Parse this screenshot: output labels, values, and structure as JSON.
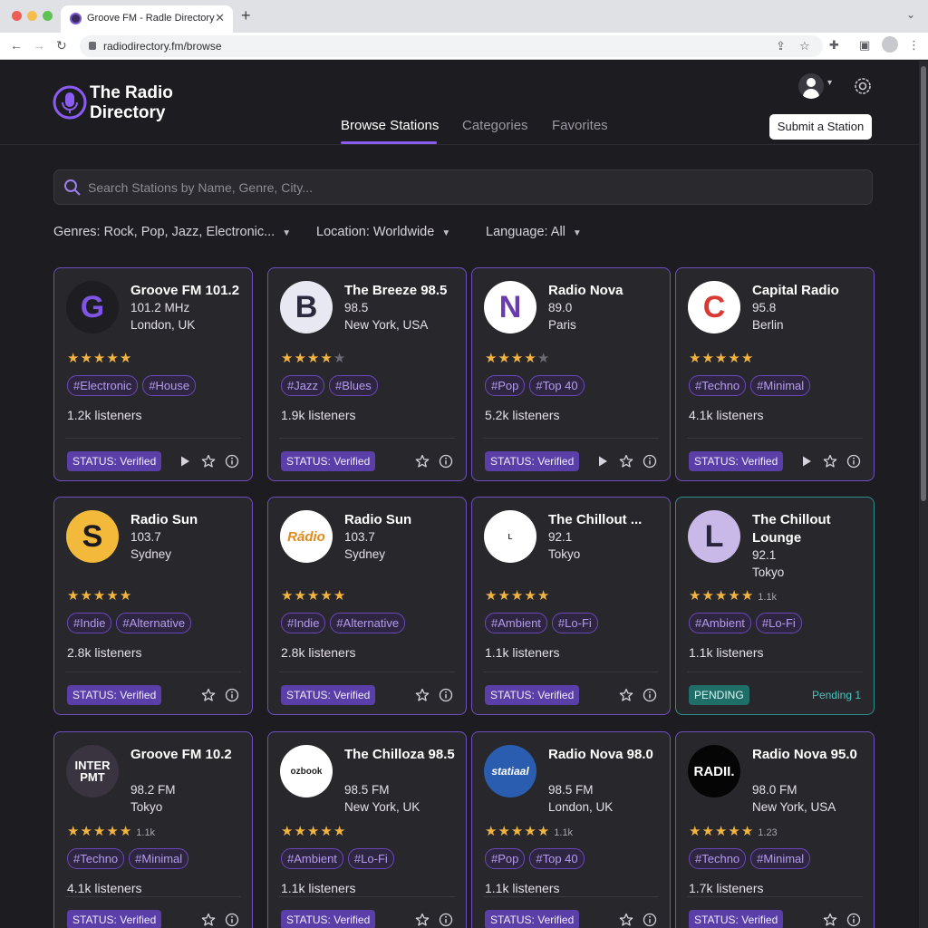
{
  "browser": {
    "tab_title": "Groove FM - Radle Directory",
    "url": "radiodirectory.fm/browse"
  },
  "app": {
    "brand": "The Radio Directory",
    "nav_tabs": [
      "Browse Stations",
      "Categories",
      "Favorites"
    ],
    "active_tab": "Browse Stations",
    "submit_label": "Submit a Station",
    "search_placeholder": "Search Stations by Name, Genre, City...",
    "filters": [
      {
        "label": "Genres:",
        "value": "Rock, Pop, Jazz, Electronic..."
      },
      {
        "label": "Location:",
        "value": "Worldwide"
      },
      {
        "label": "Language:",
        "value": "All"
      }
    ],
    "accent_color": "#8a5cf0",
    "pending_color": "#49c4bd"
  },
  "stations": [
    {
      "name": "Groove FM 101.2",
      "freq": "101.2 MHz",
      "city": "London, UK",
      "logo_text": "G",
      "logo_style": "g",
      "rating": 5,
      "stars_label": "",
      "tags": [
        "#Electronic",
        "#House"
      ],
      "listeners": "1.2k listeners",
      "status": "STATUS: Verified",
      "pending_note": "",
      "play": true
    },
    {
      "name": "The Breeze 98.5",
      "freq": "98.5",
      "city": "New York, USA",
      "logo_text": "B",
      "logo_style": "b",
      "rating": 4.5,
      "stars_label": "",
      "tags": [
        "#Jazz",
        "#Blues"
      ],
      "listeners": "1.9k listeners",
      "status": "STATUS: Verified",
      "pending_note": "",
      "play": false
    },
    {
      "name": "Radio Nova",
      "freq": "89.0",
      "city": "Paris",
      "logo_text": "N",
      "logo_style": "n",
      "rating": 4,
      "stars_label": "",
      "tags": [
        "#Pop",
        "#Top 40"
      ],
      "listeners": "5.2k listeners",
      "status": "STATUS: Verified",
      "pending_note": "",
      "play": true
    },
    {
      "name": "Capital Radio",
      "freq": "95.8",
      "city": "Berlin",
      "logo_text": "C",
      "logo_style": "c",
      "rating": 5,
      "stars_label": "",
      "tags": [
        "#Techno",
        "#Minimal"
      ],
      "listeners": "4.1k listeners",
      "status": "STATUS: Verified",
      "pending_note": "",
      "play": true
    },
    {
      "name": "Radio Sun",
      "freq": "103.7",
      "city": "Sydney",
      "logo_text": "S",
      "logo_style": "s",
      "rating": 5,
      "stars_label": "",
      "tags": [
        "#Indie",
        "#Alternative"
      ],
      "listeners": "2.8k listeners",
      "status": "STATUS: Verified",
      "pending_note": "",
      "play": false
    },
    {
      "name": "Radio Sun",
      "freq": "103.7",
      "city": "Sydney",
      "logo_text": "Rádio",
      "logo_style": "radio",
      "rating": 5,
      "stars_label": "",
      "tags": [
        "#Indie",
        "#Alternative"
      ],
      "listeners": "2.8k listeners",
      "status": "STATUS: Verified",
      "pending_note": "",
      "play": false
    },
    {
      "name": "The Chillout ...",
      "freq": "92.1",
      "city": "Tokyo",
      "logo_text": "L",
      "logo_style": "chill",
      "rating": 5,
      "stars_label": "",
      "tags": [
        "#Ambient",
        "#Lo-Fi"
      ],
      "listeners": "1.1k listeners",
      "status": "STATUS: Verified",
      "pending_note": "",
      "play": false
    },
    {
      "name": "The Chillout Lounge",
      "freq": "92.1",
      "city": "Tokyo",
      "logo_text": "L",
      "logo_style": "l",
      "rating": 5,
      "stars_label": "1.1k",
      "tags": [
        "#Ambient",
        "#Lo-Fi"
      ],
      "listeners": "1.1k listeners",
      "status": "PENDING",
      "pending_note": "Pending 1",
      "play": false
    },
    {
      "name": "Groove FM 10.2",
      "freq": "98.2 FM",
      "city": "Tokyo",
      "logo_text": "INTER PMT",
      "logo_style": "inter",
      "rating": 5,
      "stars_label": "1.1k",
      "tags": [
        "#Techno",
        "#Minimal"
      ],
      "listeners": "4.1k listeners",
      "status": "STATUS: Verified",
      "pending_note": "",
      "play": false
    },
    {
      "name": "The Chilloza 98.5",
      "freq": "98.5 FM",
      "city": "New York, UK",
      "logo_text": "ozbook",
      "logo_style": "ozbook",
      "rating": 5,
      "stars_label": "",
      "tags": [
        "#Ambient",
        "#Lo-Fi"
      ],
      "listeners": "1.1k listeners",
      "status": "STATUS: Verified",
      "pending_note": "",
      "play": false
    },
    {
      "name": "Radio Nova 98.0",
      "freq": "98.5 FM",
      "city": "London, UK",
      "logo_text": "statiaal",
      "logo_style": "station",
      "rating": 5,
      "stars_label": "1.1k",
      "tags": [
        "#Pop",
        "#Top 40"
      ],
      "listeners": "1.1k listeners",
      "status": "STATUS: Verified",
      "pending_note": "",
      "play": false
    },
    {
      "name": "Radio Nova 95.0",
      "freq": "98.0 FM",
      "city": "New York, USA",
      "logo_text": "RADII.",
      "logo_style": "radii",
      "rating": 5,
      "stars_label": "1.23",
      "tags": [
        "#Techno",
        "#Minimal"
      ],
      "listeners": "1.7k listeners",
      "status": "STATUS: Verified",
      "pending_note": "",
      "play": false
    }
  ]
}
